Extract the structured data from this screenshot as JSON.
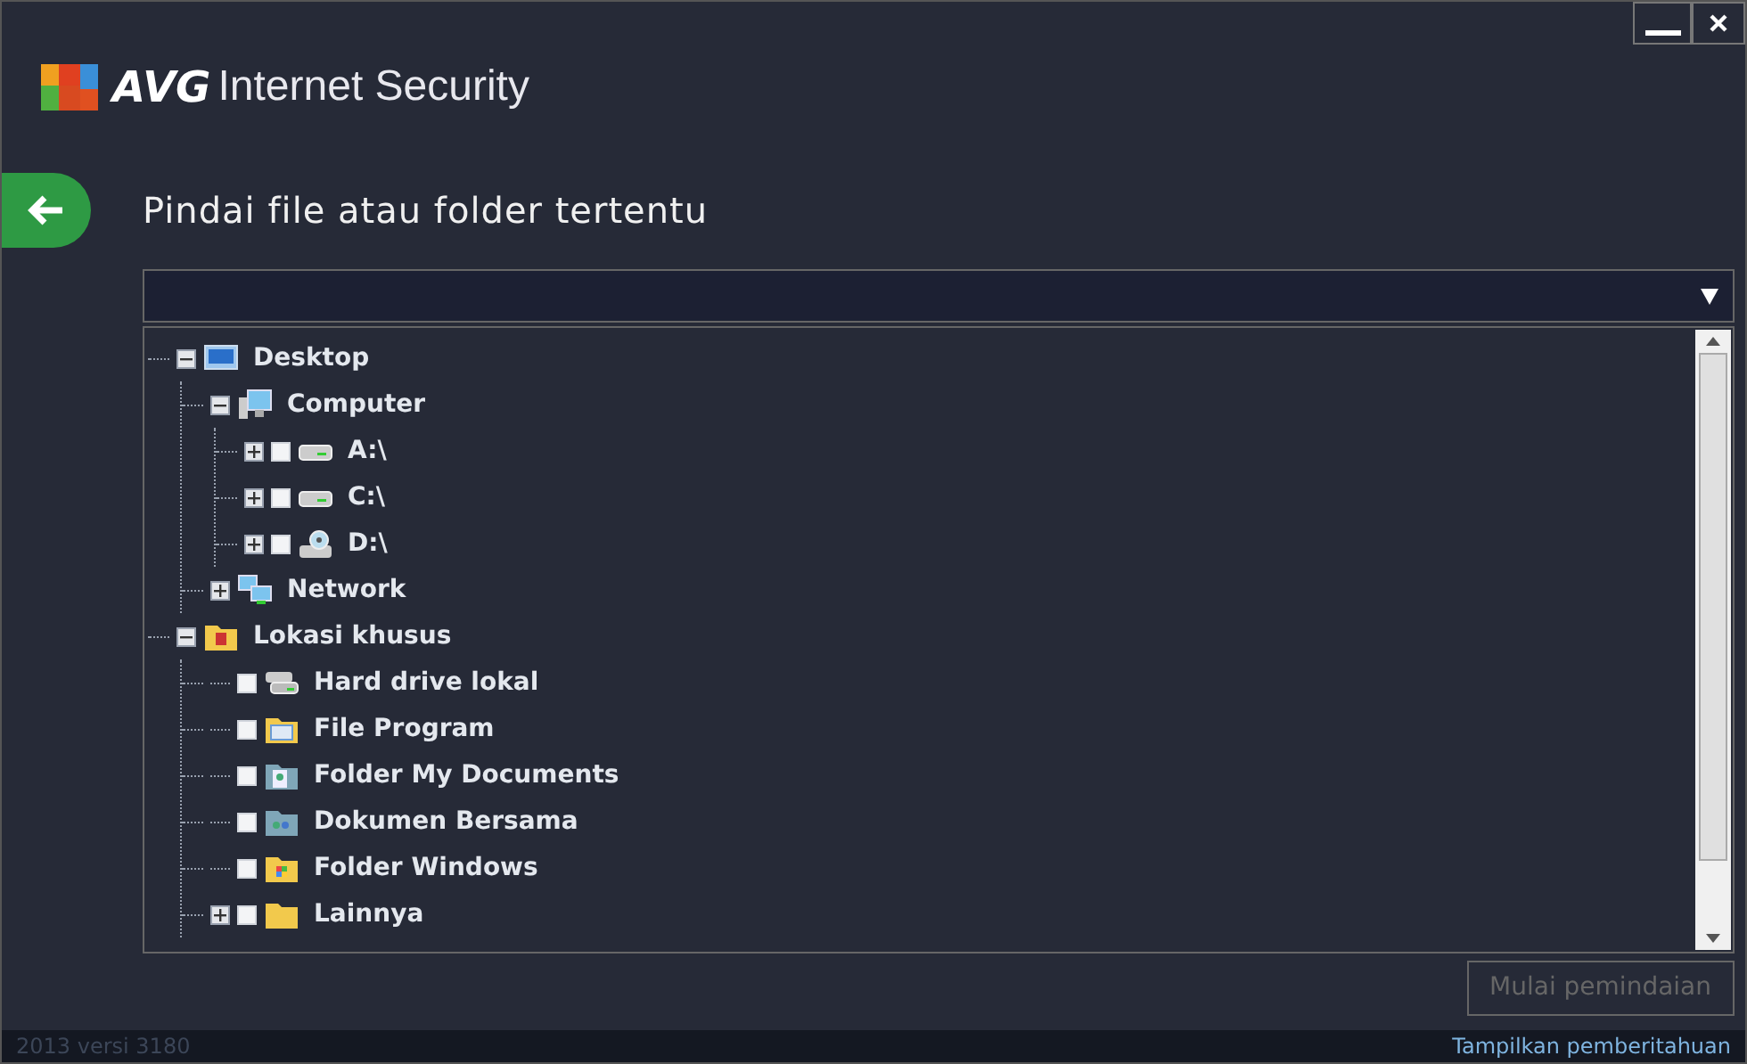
{
  "window": {
    "brand": "AVG",
    "product": "Internet Security"
  },
  "page": {
    "title": "Pindai file atau folder tertentu"
  },
  "tree": [
    {
      "label": "Desktop",
      "kind": "desktop",
      "expanded": true,
      "children": [
        {
          "label": "Computer",
          "kind": "computer",
          "expanded": true,
          "children": [
            {
              "label": "A:\\",
              "kind": "drive",
              "expanded": false,
              "checked": false
            },
            {
              "label": "C:\\",
              "kind": "drive",
              "expanded": false,
              "checked": false
            },
            {
              "label": "D:\\",
              "kind": "cd-drive",
              "expanded": false,
              "checked": false
            }
          ]
        },
        {
          "label": "Network",
          "kind": "network",
          "expanded": false
        }
      ]
    },
    {
      "label": "Lokasi khusus",
      "kind": "special-folder",
      "expanded": true,
      "children": [
        {
          "label": "Hard drive lokal",
          "kind": "hard-drives",
          "checked": false
        },
        {
          "label": "File Program",
          "kind": "program-folder",
          "checked": false
        },
        {
          "label": "Folder My Documents",
          "kind": "documents-folder",
          "checked": false
        },
        {
          "label": "Dokumen Bersama",
          "kind": "shared-folder",
          "checked": false
        },
        {
          "label": "Folder Windows",
          "kind": "windows-folder",
          "checked": false
        },
        {
          "label": "Lainnya",
          "kind": "folder",
          "expanded": false,
          "checked": false
        }
      ]
    }
  ],
  "scan_button": {
    "label": "Mulai pemindaian",
    "disabled": true
  },
  "footer": {
    "version": "2013  versi 3180",
    "link": "Tampilkan pemberitahuan"
  }
}
